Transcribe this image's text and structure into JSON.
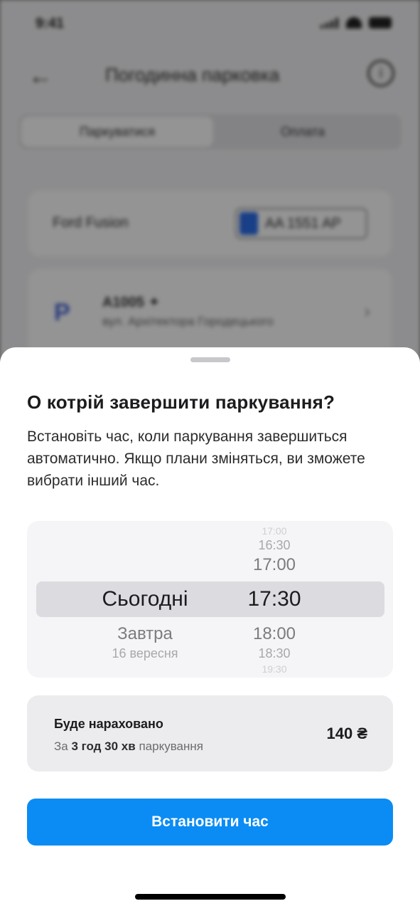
{
  "status_bar": {
    "time": "9:41"
  },
  "background": {
    "title": "Погодинна парковка",
    "back_icon": "arrow-left-icon",
    "info_icon": "info-icon",
    "info_glyph": "i",
    "tabs": [
      "Паркуватися",
      "Оплата"
    ],
    "car_name": "Ford Fusion",
    "plate": "AA 1551 AP",
    "zone_code": "A1005 ✦",
    "zone_address": "вул. Архітектора Городецького",
    "parking_icon": "P"
  },
  "sheet": {
    "title": "О котрій завершити паркування?",
    "description": "Встановіть час, коли паркування завершиться автоматично. Якщо плани зміняться, ви зможете вибрати інший час.",
    "picker": {
      "day_selected": "Сьогодні",
      "day_after_1": "Завтра",
      "day_after_2": "16 вересня",
      "time_before_3": "17:00",
      "time_before_2": "16:30",
      "time_before_1": "17:00",
      "time_selected": "17:30",
      "time_after_1": "18:00",
      "time_after_2": "18:30",
      "time_after_3": "19:30"
    },
    "charge": {
      "label": "Буде нараховано",
      "prefix": "За",
      "duration": "3 год 30 хв",
      "suffix": "паркування",
      "price": "140 ₴"
    },
    "button_label": "Встановити час"
  },
  "colors": {
    "accent": "#0a8cf4",
    "sheet_bg": "#ffffff",
    "overlay": "#000000"
  }
}
